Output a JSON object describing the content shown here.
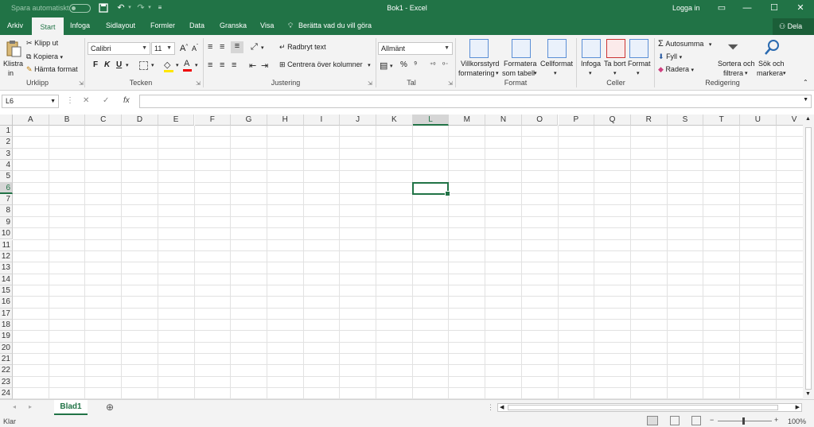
{
  "titlebar": {
    "autosave_label": "Spara automatiskt",
    "document_title": "Bok1  -  Excel",
    "login_label": "Logga in"
  },
  "tabs": {
    "file": "Arkiv",
    "home": "Start",
    "insert": "Infoga",
    "page_layout": "Sidlayout",
    "formulas": "Formler",
    "data": "Data",
    "review": "Granska",
    "view": "Visa",
    "tell_me": "Berätta vad du vill göra",
    "share": "Dela"
  },
  "clipboard": {
    "paste_line1": "Klistra",
    "paste_line2": "in",
    "cut": "Klipp ut",
    "copy": "Kopiera",
    "format_painter": "Hämta format",
    "group": "Urklipp"
  },
  "font": {
    "name": "Calibri",
    "size": "11",
    "grow": "A",
    "shrink": "A",
    "bold": "F",
    "italic": "K",
    "underline": "U",
    "font_color": "A",
    "group": "Tecken"
  },
  "alignment": {
    "wrap_text": "Radbryt text",
    "merge_center": "Centrera över kolumner",
    "group": "Justering"
  },
  "number": {
    "format": "Allmänt",
    "percent": "%",
    "comma": "⁹",
    "group": "Tal"
  },
  "styles": {
    "conditional_line1": "Villkorsstyrd",
    "conditional_line2": "formatering",
    "table_line1": "Formatera",
    "table_line2": "som tabell",
    "cell_styles": "Cellformat",
    "group": "Format"
  },
  "cells": {
    "insert": "Infoga",
    "delete": "Ta bort",
    "format": "Format",
    "group": "Celler"
  },
  "editing": {
    "autosum": "Autosumma",
    "fill": "Fyll",
    "clear": "Radera",
    "sort_line1": "Sortera och",
    "sort_line2": "filtrera",
    "find_line1": "Sök och",
    "find_line2": "markera",
    "group": "Redigering"
  },
  "formula_bar": {
    "name_box": "L6",
    "fx": "fx",
    "cancel": "✕",
    "enter": "✓",
    "content": ""
  },
  "columns": [
    "A",
    "B",
    "C",
    "D",
    "E",
    "F",
    "G",
    "H",
    "I",
    "J",
    "K",
    "L",
    "M",
    "N",
    "O",
    "P",
    "Q",
    "R",
    "S",
    "T",
    "U",
    "V"
  ],
  "rows": [
    "1",
    "2",
    "3",
    "4",
    "5",
    "6",
    "7",
    "8",
    "9",
    "10",
    "11",
    "12",
    "13",
    "14",
    "15",
    "16",
    "17",
    "18",
    "19",
    "20",
    "21",
    "22",
    "23",
    "24"
  ],
  "active_cell": {
    "column": "L",
    "row": "6"
  },
  "sheets": {
    "active": "Blad1"
  },
  "status": {
    "ready": "Klar",
    "zoom": "100%"
  },
  "colors": {
    "accent": "#217346"
  }
}
